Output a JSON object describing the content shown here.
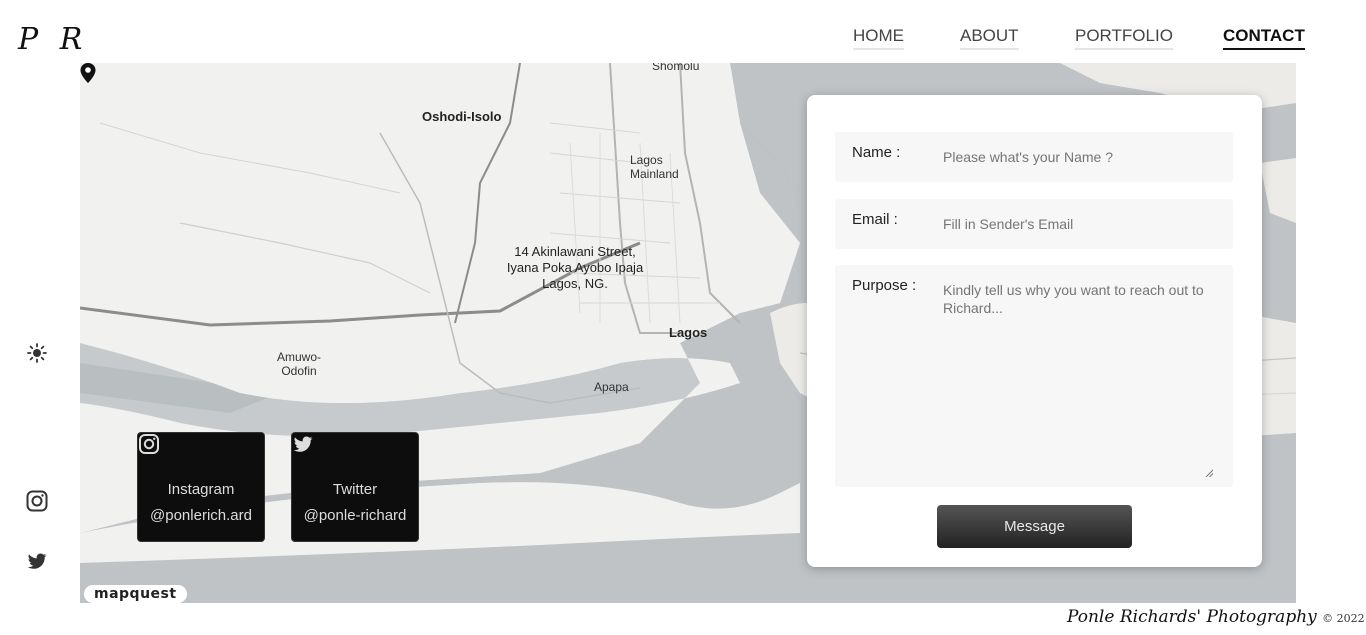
{
  "logo": {
    "text": "P R"
  },
  "nav": {
    "items": [
      {
        "label": "HOME"
      },
      {
        "label": "ABOUT"
      },
      {
        "label": "PORTFOLIO"
      },
      {
        "label": "CONTACT"
      }
    ],
    "active": "CONTACT"
  },
  "map": {
    "labels": {
      "shomolu": "Shomolu",
      "oshodi": "Oshodi-Isolo",
      "lagos_mainland_1": "Lagos",
      "lagos_mainland_2": "Mainland",
      "lagos": "Lagos",
      "amuwo_1": "Amuwo-",
      "amuwo_2": "Odofin",
      "apapa": "Apapa"
    },
    "address": {
      "line1": "14 Akinlawani Street,",
      "line2": "Iyana Poka Ayobo Ipaja",
      "line3": "Lagos, NG."
    },
    "attribution": "mapquest",
    "colors": {
      "land": "#f1f1ef",
      "water": "#bfc3c6",
      "road": "#b4b4b4"
    }
  },
  "social": {
    "instagram": {
      "label": "Instagram",
      "handle": "@ponlerich.ard",
      "icon": "instagram-icon"
    },
    "twitter": {
      "label": "Twitter",
      "handle": "@ponle-richard",
      "icon": "twitter-icon"
    }
  },
  "sidebar": {
    "theme_icon": "sun-icon",
    "instagram_icon": "instagram-icon",
    "twitter_icon": "twitter-icon"
  },
  "form": {
    "name": {
      "label": "Name :",
      "placeholder": "Please what's your Name ?"
    },
    "email": {
      "label": "Email :",
      "placeholder": "Fill in Sender's Email"
    },
    "purpose": {
      "label": "Purpose :",
      "placeholder": "Kindly tell us why you want to reach out to Richard..."
    },
    "submit_label": "Message"
  },
  "footer": {
    "text": "Ponle Richards' Photography",
    "copyright": "© 2022"
  }
}
